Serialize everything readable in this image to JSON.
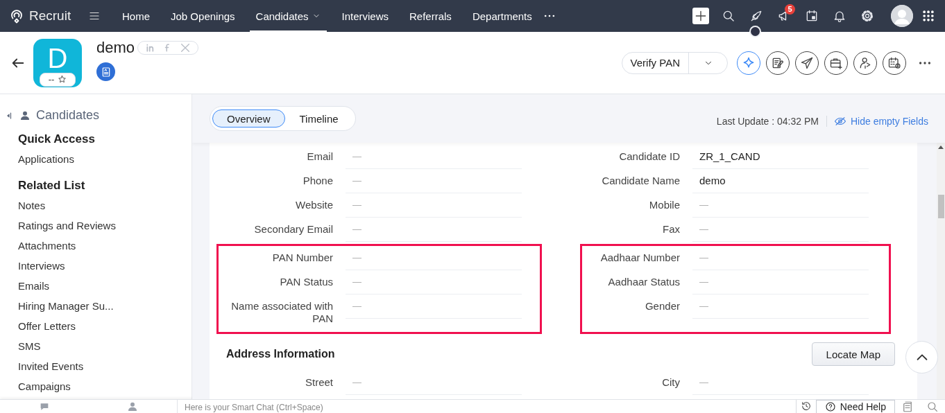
{
  "nav": {
    "brand": "Recruit",
    "items": [
      {
        "label": "Home",
        "selected": false,
        "dropdown": false
      },
      {
        "label": "Job Openings",
        "selected": false,
        "dropdown": false
      },
      {
        "label": "Candidates",
        "selected": true,
        "dropdown": true
      },
      {
        "label": "Interviews",
        "selected": false,
        "dropdown": false
      },
      {
        "label": "Referrals",
        "selected": false,
        "dropdown": false
      },
      {
        "label": "Departments",
        "selected": false,
        "dropdown": false
      }
    ],
    "badge": "5"
  },
  "header": {
    "initial": "D",
    "rating": "--",
    "name": "demo",
    "action": "Verify PAN"
  },
  "sidebar": {
    "title": "Candidates",
    "sections": [
      {
        "heading": "Quick Access",
        "items": [
          "Applications"
        ]
      },
      {
        "heading": "Related List",
        "items": [
          "Notes",
          "Ratings and Reviews",
          "Attachments",
          "Interviews",
          "Emails",
          "Hiring Manager Su...",
          "Offer Letters",
          "SMS",
          "Invited Events",
          "Campaigns"
        ]
      }
    ]
  },
  "tabs": [
    {
      "label": "Overview",
      "selected": true
    },
    {
      "label": "Timeline",
      "selected": false
    }
  ],
  "last_update": "Last Update : 04:32 PM",
  "hide_empty": "Hide empty Fields",
  "field_groups": [
    {
      "highlighted": false,
      "left": [
        {
          "label": "Email",
          "value": "—"
        },
        {
          "label": "Phone",
          "value": "—"
        },
        {
          "label": "Website",
          "value": "—"
        },
        {
          "label": "Secondary Email",
          "value": "—"
        }
      ],
      "right": [
        {
          "label": "Candidate ID",
          "value": "ZR_1_CAND"
        },
        {
          "label": "Candidate Name",
          "value": "demo"
        },
        {
          "label": "Mobile",
          "value": "—"
        },
        {
          "label": "Fax",
          "value": "—"
        }
      ]
    },
    {
      "highlighted": true,
      "left": [
        {
          "label": "PAN Number",
          "value": "—"
        },
        {
          "label": "PAN Status",
          "value": "—"
        },
        {
          "label": "Name associated with PAN",
          "value": "—"
        }
      ],
      "right": [
        {
          "label": "Aadhaar Number",
          "value": "—"
        },
        {
          "label": "Aadhaar Status",
          "value": "—"
        },
        {
          "label": "Gender",
          "value": "—"
        }
      ]
    }
  ],
  "address": {
    "title": "Address Information",
    "button": "Locate Map",
    "left": [
      {
        "label": "Street",
        "value": "—"
      }
    ],
    "right": [
      {
        "label": "City",
        "value": "—"
      }
    ]
  },
  "smart_chat": {
    "placeholder": "Here is your Smart Chat (Ctrl+Space)"
  },
  "help": "Need Help"
}
